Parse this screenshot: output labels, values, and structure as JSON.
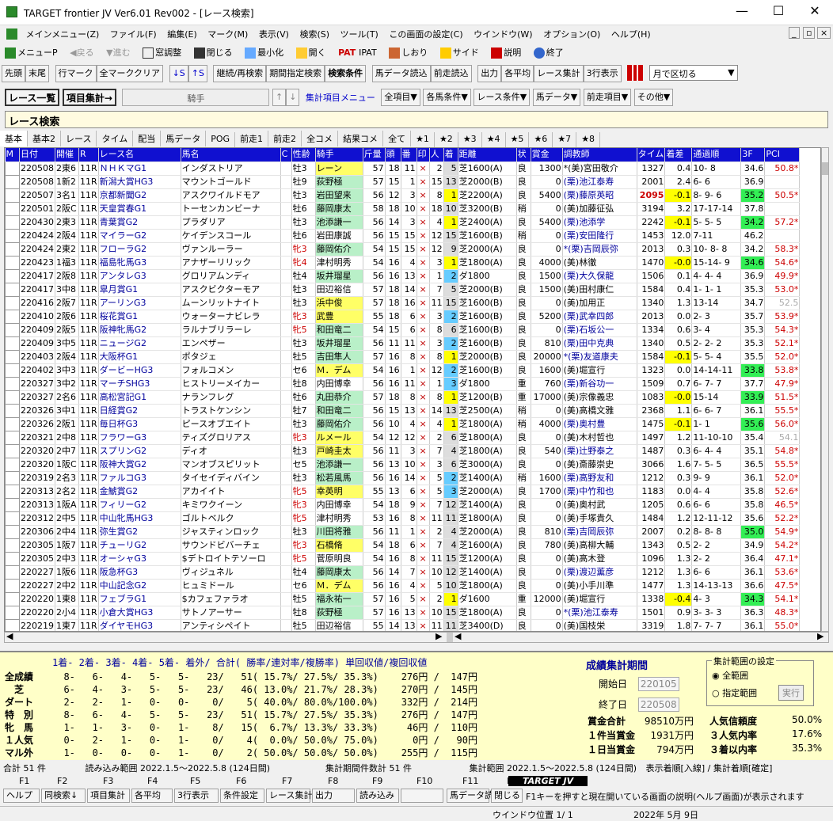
{
  "app": {
    "title": "TARGET frontier JV  Ver6.01  Rev002 - [レース検索]",
    "min": "—",
    "max": "☐",
    "close": "✕"
  },
  "menu": [
    "メインメニュー(Z)",
    "ファイル(F)",
    "編集(E)",
    "マーク(M)",
    "表示(V)",
    "検索(S)",
    "ツール(T)",
    "この画面の設定(C)",
    "ウインドウ(W)",
    "オプション(O)",
    "ヘルプ(H)"
  ],
  "toolbar1": [
    "メニューP",
    "戻る",
    "進む",
    "窓調整",
    "閉じる",
    "最小化",
    "開く",
    "IPAT",
    "しおり",
    "サイド",
    "説明",
    "終了"
  ],
  "toolbar2": [
    "先頭",
    "末尾",
    "行マーク",
    "全マーククリア",
    "↓S",
    "↑S",
    "継続/再検索",
    "期間指定検索",
    "検索条件",
    "馬データ読込",
    "前走読込",
    "出力",
    "各平均",
    "レース集計",
    "3行表示"
  ],
  "toolbar2_select": "月で区切る",
  "toolbar3": {
    "list": "レース一覧",
    "agg": "項目集計→",
    "field": "騎手",
    "menu": "集計項目メニュー",
    "items": [
      "全項目▼",
      "各馬条件▼",
      "レース条件▼",
      "馬データ▼",
      "前走項目▼",
      "その他▼"
    ]
  },
  "section_title": "レース検索",
  "tabs": [
    "基本",
    "基本2",
    "レース",
    "タイム",
    "配当",
    "馬データ",
    "POG",
    "前走1",
    "前走2",
    "全コメ",
    "結果コメ",
    "全て",
    "★1",
    "★2",
    "★3",
    "★4",
    "★5",
    "★6",
    "★7",
    "★8"
  ],
  "columns": [
    "M",
    "日付",
    "開催",
    "R",
    "レース名",
    "馬名",
    "C",
    "性齢",
    "騎手",
    "斤量",
    "頭",
    "番",
    "印",
    "人",
    "着",
    "距離",
    "状",
    "賞金",
    "調教師",
    "タイム",
    "着差",
    "通過順",
    "3F",
    "PCI"
  ],
  "rows": [
    [
      "",
      "220508",
      "2東6",
      "11R",
      "ＮＨＫマG1",
      "インダストリア",
      "",
      "牡3",
      "レーン",
      "57",
      "18",
      "11",
      "×",
      "2",
      "5",
      "芝1600(A)",
      "良",
      "1300",
      "*(美)宮田敬介",
      "1327",
      "0.4",
      "10- 8",
      "34.6",
      "50.8*"
    ],
    [
      "",
      "220508",
      "1新2",
      "11R",
      "新潟大賞HG3",
      "マウントゴールド",
      "",
      "牡9",
      "荻野極",
      "57",
      "15",
      "1",
      "×",
      "15",
      "13",
      "芝2000(B)",
      "良",
      "0",
      "(栗)池江泰寿",
      "2001",
      "2.4",
      "6- 6",
      "36.9",
      ""
    ],
    [
      "",
      "220507",
      "3名1",
      "11R",
      "京都新聞G2",
      "アスクワイルドモア",
      "",
      "牡3",
      "岩田望来",
      "56",
      "12",
      "3",
      "×",
      "8",
      "1",
      "芝2200(A)",
      "良",
      "5400",
      "(栗)藤原英昭",
      "2095",
      "-0.1",
      "8- 9- 6",
      "35.2",
      "50.5*"
    ],
    [
      "",
      "220501",
      "2阪C",
      "11R",
      "天皇賞春G1",
      "トーセンカンビーナ",
      "",
      "牡6",
      "藤岡康太",
      "58",
      "18",
      "10",
      "×",
      "18",
      "10",
      "芝3200(B)",
      "稍",
      "0",
      "(美)加藤征弘",
      "3194",
      "3.2",
      "17-17-14",
      "37.8",
      ""
    ],
    [
      "",
      "220430",
      "2東3",
      "11R",
      "青葉賞G2",
      "プラダリア",
      "",
      "牡3",
      "池添謙一",
      "56",
      "14",
      "3",
      "×",
      "4",
      "1",
      "芝2400(A)",
      "良",
      "5400",
      "(栗)池添学",
      "2242",
      "-0.1",
      "5- 5- 5",
      "34.2",
      "57.2*"
    ],
    [
      "",
      "220424",
      "2阪4",
      "11R",
      "マイラーG2",
      "ケイデンスコール",
      "",
      "牡6",
      "岩田康誠",
      "56",
      "15",
      "15",
      "×",
      "12",
      "15",
      "芝1600(B)",
      "稍",
      "0",
      "(栗)安田隆行",
      "1453",
      "12.0",
      "7-11",
      "46.2",
      ""
    ],
    [
      "",
      "220424",
      "2東2",
      "11R",
      "フローラG2",
      "ヴァンルーラー",
      "",
      "牝3",
      "藤岡佑介",
      "54",
      "15",
      "15",
      "×",
      "12",
      "9",
      "芝2000(A)",
      "良",
      "0",
      "*(栗)吉岡辰弥",
      "2013",
      "0.3",
      "10- 8- 8",
      "34.2",
      "58.3*"
    ],
    [
      "",
      "220423",
      "1福3",
      "11R",
      "福島牝馬G3",
      "アナザーリリック",
      "",
      "牝4",
      "津村明秀",
      "54",
      "16",
      "4",
      "×",
      "3",
      "1",
      "芝1800(A)",
      "良",
      "4000",
      "(美)林徹",
      "1470",
      "-0.0",
      "15-14- 9",
      "34.6",
      "54.6*"
    ],
    [
      "",
      "220417",
      "2阪8",
      "11R",
      "アンタレG3",
      "グロリアムンディ",
      "",
      "牡4",
      "坂井瑠星",
      "56",
      "16",
      "13",
      "×",
      "1",
      "2",
      "ダ1800",
      "良",
      "1500",
      "(栗)大久保龍",
      "1506",
      "0.1",
      "4- 4- 4",
      "36.9",
      "49.9*"
    ],
    [
      "",
      "220417",
      "3中8",
      "11R",
      "皐月賞G1",
      "アスクビクターモア",
      "",
      "牡3",
      "田辺裕信",
      "57",
      "18",
      "14",
      "×",
      "7",
      "5",
      "芝2000(B)",
      "良",
      "1500",
      "(美)田村康仁",
      "1584",
      "0.4",
      "1- 1- 1",
      "35.3",
      "53.0*"
    ],
    [
      "",
      "220416",
      "2阪7",
      "11R",
      "アーリンG3",
      "ムーンリットナイト",
      "",
      "牡3",
      "浜中俊",
      "57",
      "18",
      "16",
      "×",
      "11",
      "15",
      "芝1600(B)",
      "良",
      "0",
      "(美)加用正",
      "1340",
      "1.3",
      "13-14",
      "34.7",
      "52.5"
    ],
    [
      "",
      "220410",
      "2阪6",
      "11R",
      "桜花賞G1",
      "ウォーターナビレラ",
      "",
      "牝3",
      "武豊",
      "55",
      "18",
      "6",
      "×",
      "3",
      "2",
      "芝1600(B)",
      "良",
      "5200",
      "(栗)武幸四郎",
      "2013",
      "0.0",
      "2- 3",
      "35.7",
      "53.9*"
    ],
    [
      "",
      "220409",
      "2阪5",
      "11R",
      "阪神牝馬G2",
      "ラルナブリラーレ",
      "",
      "牝5",
      "和田竜二",
      "54",
      "15",
      "6",
      "×",
      "8",
      "6",
      "芝1600(B)",
      "良",
      "0",
      "(栗)石坂公一",
      "1334",
      "0.6",
      "3- 4",
      "35.3",
      "54.3*"
    ],
    [
      "",
      "220409",
      "3中5",
      "11R",
      "ニュージG2",
      "エンペザー",
      "",
      "牡3",
      "坂井瑠星",
      "56",
      "11",
      "11",
      "×",
      "3",
      "2",
      "芝1600(B)",
      "良",
      "810",
      "(栗)田中克典",
      "1340",
      "0.5",
      "2- 2- 2",
      "35.3",
      "52.1*"
    ],
    [
      "",
      "220403",
      "2阪4",
      "11R",
      "大阪杯G1",
      "ポタジェ",
      "",
      "牡5",
      "吉田隼人",
      "57",
      "16",
      "8",
      "×",
      "8",
      "1",
      "芝2000(B)",
      "良",
      "20000",
      "*(栗)友道康夫",
      "1584",
      "-0.1",
      "5- 5- 4",
      "35.5",
      "52.0*"
    ],
    [
      "",
      "220402",
      "3中3",
      "11R",
      "ダービーHG3",
      "フォルコメン",
      "",
      "セ6",
      "Ｍ．デム",
      "54",
      "16",
      "1",
      "×",
      "12",
      "2",
      "芝1600(B)",
      "良",
      "1600",
      "(美)堀宣行",
      "1323",
      "0.0",
      "14-14-11",
      "33.8",
      "53.8*"
    ],
    [
      "",
      "220327",
      "3中2",
      "11R",
      "マーチSHG3",
      "ヒストリーメイカー",
      "",
      "牡8",
      "内田博幸",
      "56",
      "16",
      "11",
      "×",
      "1",
      "3",
      "ダ1800",
      "重",
      "760",
      "(栗)新谷功一",
      "1509",
      "0.7",
      "6- 7- 7",
      "37.7",
      "47.9*"
    ],
    [
      "",
      "220327",
      "2名6",
      "11R",
      "高松宮記G1",
      "ナランフレグ",
      "",
      "牡6",
      "丸田恭介",
      "57",
      "18",
      "8",
      "×",
      "8",
      "1",
      "芝1200(B)",
      "重",
      "17000",
      "(美)宗像義忠",
      "1083",
      "-0.0",
      "15-14",
      "33.9",
      "51.5*"
    ],
    [
      "",
      "220326",
      "3中1",
      "11R",
      "日経賞G2",
      "トラストケンシン",
      "",
      "牡7",
      "和田竜二",
      "56",
      "15",
      "13",
      "×",
      "14",
      "13",
      "芝2500(A)",
      "稍",
      "0",
      "(美)高橋文雅",
      "2368",
      "1.1",
      "6- 6- 7",
      "36.1",
      "55.5*"
    ],
    [
      "",
      "220326",
      "2阪1",
      "11R",
      "毎日杯G3",
      "ピースオブエイト",
      "",
      "牡3",
      "藤岡佑介",
      "56",
      "10",
      "4",
      "×",
      "4",
      "1",
      "芝1800(A)",
      "稍",
      "4000",
      "(栗)奥村豊",
      "1475",
      "-0.1",
      "1- 1",
      "35.6",
      "56.0*"
    ],
    [
      "",
      "220321",
      "2中8",
      "11R",
      "フラワーG3",
      "ティズグロリアス",
      "",
      "牝3",
      "ルメール",
      "54",
      "12",
      "12",
      "×",
      "2",
      "6",
      "芝1800(A)",
      "良",
      "0",
      "(美)木村哲也",
      "1497",
      "1.2",
      "11-10-10",
      "35.4",
      "54.1"
    ],
    [
      "",
      "220320",
      "2中7",
      "11R",
      "スプリンG2",
      "ディオ",
      "",
      "牡3",
      "戸崎圭太",
      "56",
      "11",
      "3",
      "×",
      "7",
      "4",
      "芝1800(A)",
      "良",
      "540",
      "(栗)辻野泰之",
      "1487",
      "0.3",
      "6- 4- 4",
      "35.1",
      "54.8*"
    ],
    [
      "",
      "220320",
      "1阪C",
      "11R",
      "阪神大賞G2",
      "マンオブスピリット",
      "",
      "セ5",
      "池添謙一",
      "56",
      "13",
      "10",
      "×",
      "3",
      "6",
      "芝3000(A)",
      "良",
      "0",
      "(美)斎藤崇史",
      "3066",
      "1.6",
      "7- 5- 5",
      "36.5",
      "55.5*"
    ],
    [
      "",
      "220319",
      "2名3",
      "11R",
      "ファルコG3",
      "タイセイディバイン",
      "",
      "牡3",
      "松若風馬",
      "56",
      "16",
      "14",
      "×",
      "5",
      "2",
      "芝1400(A)",
      "稍",
      "1600",
      "(栗)高野友和",
      "1212",
      "0.3",
      "9- 9",
      "36.1",
      "52.0*"
    ],
    [
      "",
      "220313",
      "2名2",
      "11R",
      "金鯱賞G2",
      "アカイイト",
      "",
      "牝5",
      "幸英明",
      "55",
      "13",
      "6",
      "×",
      "5",
      "3",
      "芝2000(A)",
      "良",
      "1700",
      "(栗)中竹和也",
      "1183",
      "0.0",
      "4- 4",
      "35.8",
      "52.6*"
    ],
    [
      "",
      "220313",
      "1阪A",
      "11R",
      "フィリーG2",
      "キミワクイーン",
      "",
      "牝3",
      "内田博幸",
      "54",
      "18",
      "9",
      "×",
      "7",
      "12",
      "芝1400(A)",
      "良",
      "0",
      "(美)奥村武",
      "1205",
      "0.6",
      "6- 6",
      "35.8",
      "46.5*"
    ],
    [
      "",
      "220312",
      "2中5",
      "11R",
      "中山牝馬HG3",
      "ゴルトベルク",
      "",
      "牝5",
      "津村明秀",
      "53",
      "16",
      "8",
      "×",
      "11",
      "11",
      "芝1800(A)",
      "良",
      "0",
      "(美)手塚貴久",
      "1484",
      "1.2",
      "12-11-12",
      "35.6",
      "52.2*"
    ],
    [
      "",
      "220306",
      "2中4",
      "11R",
      "弥生賞G2",
      "ジャスティンロック",
      "",
      "牡3",
      "川田将雅",
      "56",
      "11",
      "1",
      "×",
      "2",
      "4",
      "芝2000(A)",
      "良",
      "810",
      "(栗)吉岡辰弥",
      "2007",
      "0.2",
      "8- 8- 8",
      "35.0",
      "54.9*"
    ],
    [
      "",
      "220305",
      "1阪7",
      "11R",
      "チューリG2",
      "サウンドビバーチェ",
      "",
      "牝3",
      "石橋脩",
      "54",
      "18",
      "6",
      "×",
      "7",
      "4",
      "芝1600(A)",
      "良",
      "780",
      "(美)高柳大輔",
      "1343",
      "0.5",
      "2- 2",
      "34.9",
      "54.2*"
    ],
    [
      "",
      "220305",
      "2中3",
      "11R",
      "オーシャG3",
      "$デトロイトテソーロ",
      "",
      "牝5",
      "菅原明良",
      "54",
      "16",
      "8",
      "×",
      "11",
      "15",
      "芝1200(A)",
      "良",
      "0",
      "(美)高木登",
      "1096",
      "1.3",
      "2- 2",
      "36.4",
      "47.1*"
    ],
    [
      "",
      "220227",
      "1阪6",
      "11R",
      "阪急杯G3",
      "ヴィジュネル",
      "",
      "牡4",
      "藤岡康太",
      "56",
      "14",
      "7",
      "×",
      "10",
      "12",
      "芝1400(A)",
      "良",
      "0",
      "(栗)渡辺薫彦",
      "1212",
      "1.3",
      "6- 6",
      "36.1",
      "53.6*"
    ],
    [
      "",
      "220227",
      "2中2",
      "11R",
      "中山記念G2",
      "ヒュミドール",
      "",
      "セ6",
      "Ｍ．デム",
      "56",
      "16",
      "4",
      "×",
      "5",
      "10",
      "芝1800(A)",
      "良",
      "0",
      "(美)小手川準",
      "1477",
      "1.3",
      "14-13-13",
      "36.6",
      "47.5*"
    ],
    [
      "",
      "220220",
      "1東8",
      "11R",
      "フェブラG1",
      "$カフェファラオ",
      "",
      "牡5",
      "福永祐一",
      "57",
      "16",
      "5",
      "×",
      "2",
      "1",
      "ダ1600",
      "重",
      "12000",
      "(美)堀宣行",
      "1338",
      "-0.4",
      "4- 3",
      "34.3",
      "54.1*"
    ],
    [
      "",
      "220220",
      "2小4",
      "11R",
      "小倉大賞HG3",
      "サトノアーサー",
      "",
      "牡8",
      "荻野極",
      "57",
      "16",
      "13",
      "×",
      "10",
      "15",
      "芝1800(A)",
      "良",
      "0",
      "*(栗)池江泰寿",
      "1501",
      "0.9",
      "3- 3- 3",
      "36.3",
      "48.3*"
    ],
    [
      "",
      "220219",
      "1東7",
      "11R",
      "ダイヤモHG3",
      "アンティシペイト",
      "",
      "牡5",
      "田辺裕信",
      "55",
      "14",
      "13",
      "×",
      "11",
      "11",
      "芝3400(D)",
      "良",
      "0",
      "(美)国枝栄",
      "3319",
      "1.8",
      "7- 7- 7",
      "36.1",
      "55.0*"
    ]
  ],
  "stats": {
    "header": "1着- 2着- 3着- 4着- 5着- 着外/ 合計(  勝率/連対率/複勝率) 単回収値/複回収値",
    "rows": [
      {
        "label": "全成績",
        "value": "  8-   6-   4-   5-   5-   23/   51( 15.7%/ 27.5%/ 35.3%)    276円 /  147円"
      },
      {
        "label": "　芝",
        "value": "  6-   4-   3-   5-   5-   23/   46( 13.0%/ 21.7%/ 28.3%)    270円 /  145円"
      },
      {
        "label": "ダート",
        "value": "  2-   2-   1-   0-   0-    0/    5( 40.0%/ 80.0%/100.0%)    332円 /  214円"
      },
      {
        "label": "特　別",
        "value": "  8-   6-   4-   5-   5-   23/   51( 15.7%/ 27.5%/ 35.3%)    276円 /  147円"
      },
      {
        "label": "牝　馬",
        "value": "  1-   1-   3-   0-   1-    8/   15(  6.7%/ 13.3%/ 33.3%)     46円 /  110円"
      },
      {
        "label": "１人気",
        "value": "  0-   2-   1-   0-   1-    0/    4(  0.0%/ 50.0%/ 75.0%)      0円 /   90円"
      },
      {
        "label": "マル外",
        "value": "  1-   0-   0-   0-   1-    0/    2( 50.0%/ 50.0%/ 50.0%)    255円 /  115円"
      }
    ],
    "period_title": "成績集計期間",
    "start_label": "開始日",
    "start": "220105",
    "end_label": "終了日",
    "end": "220508",
    "range_title": "集計範囲の設定",
    "range_all": "全範囲",
    "range_spec": "指定範囲",
    "exec": "実行",
    "summary": [
      {
        "label": "賞金合計",
        "value": "98510万円"
      },
      {
        "label": "１件当賞金",
        "value": "1931万円"
      },
      {
        "label": "１日当賞金",
        "value": "794万円"
      }
    ],
    "summary2": [
      {
        "label": "人気信頼度",
        "value": "50.0%"
      },
      {
        "label": "３人気内率",
        "value": "17.6%"
      },
      {
        "label": "３着以内率",
        "value": "35.3%"
      }
    ]
  },
  "status1": [
    "合計 51 件",
    "読み込み範囲 2022.1.5～2022.5.8 (124日間)",
    "集計期間件数計 51 件",
    "集計範囲 2022.1.5～2022.5.8 (124日間)",
    "表示着順[入線] / 集計着順[確定]"
  ],
  "fkeys_top": [
    "F1",
    "F2",
    "F3",
    "F4",
    "F5",
    "F6",
    "F7",
    "F8",
    "F9",
    "F10",
    "F11",
    "F12"
  ],
  "fkeys": [
    "ヘルプ",
    "同検索↓",
    "項目集計",
    "各平均",
    "3行表示",
    "条件設定",
    "レース集計",
    "出力",
    "読み込み",
    "",
    "馬データ読",
    "閉じる"
  ],
  "fkey_help": "F1キーを押すと現在開いている画面の説明(ヘルプ画面)が表示されます",
  "brand": "TARGET JV",
  "status2": {
    "window": "ウインドウ位置 1/ 1",
    "date": "2022年 5月 9日"
  }
}
